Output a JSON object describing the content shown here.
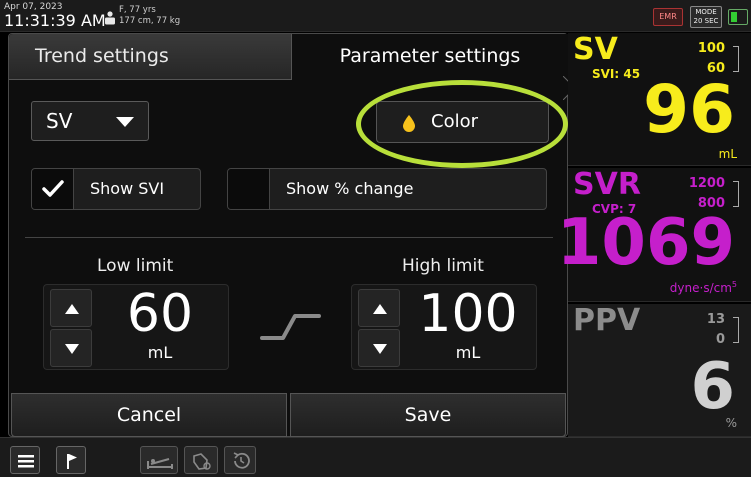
{
  "status_bar": {
    "date": "Apr 07, 2023",
    "time": "11:31:39 AM",
    "patient_line1": "F, 77 yrs",
    "patient_line2": "177 cm, 77 kg",
    "emr_label": "EMR",
    "mode_label": "MODE",
    "mode_value": "20 SEC"
  },
  "dialog": {
    "tabs": [
      {
        "label": "Trend settings",
        "active": false
      },
      {
        "label": "Parameter settings",
        "active": true
      }
    ],
    "parameter_select": "SV",
    "color_button": "Color",
    "checkboxes": [
      {
        "label": "Show SVI",
        "checked": true
      },
      {
        "label": "Show % change",
        "checked": false
      }
    ],
    "low_limit": {
      "title": "Low limit",
      "value": "60",
      "unit": "mL"
    },
    "high_limit": {
      "title": "High limit",
      "value": "100",
      "unit": "mL"
    },
    "cancel_label": "Cancel",
    "save_label": "Save"
  },
  "tiles": {
    "sv": {
      "name": "SV",
      "sub": "SVI: 45",
      "high": "100",
      "low": "60",
      "value": "96",
      "unit": "mL",
      "color": "#f7ec1c"
    },
    "svr": {
      "name": "SVR",
      "sub": "CVP: 7",
      "high": "1200",
      "low": "800",
      "value": "1069",
      "unit": "dyne·s/cm",
      "unit_sup": "5",
      "color": "#c51fcb"
    },
    "ppv": {
      "name": "PPV",
      "high": "13",
      "low": "0",
      "value": "6",
      "unit": "%",
      "color": "#8c8c8c"
    }
  },
  "colors": {
    "highlight_ellipse": "#b8df3a",
    "color_drop": "#f7c21c"
  },
  "icons": [
    "patient-icon",
    "drop-icon",
    "check-icon",
    "menu-icon",
    "flag-icon",
    "bed-icon",
    "hand-sensor-icon",
    "history-icon",
    "link-icon"
  ]
}
